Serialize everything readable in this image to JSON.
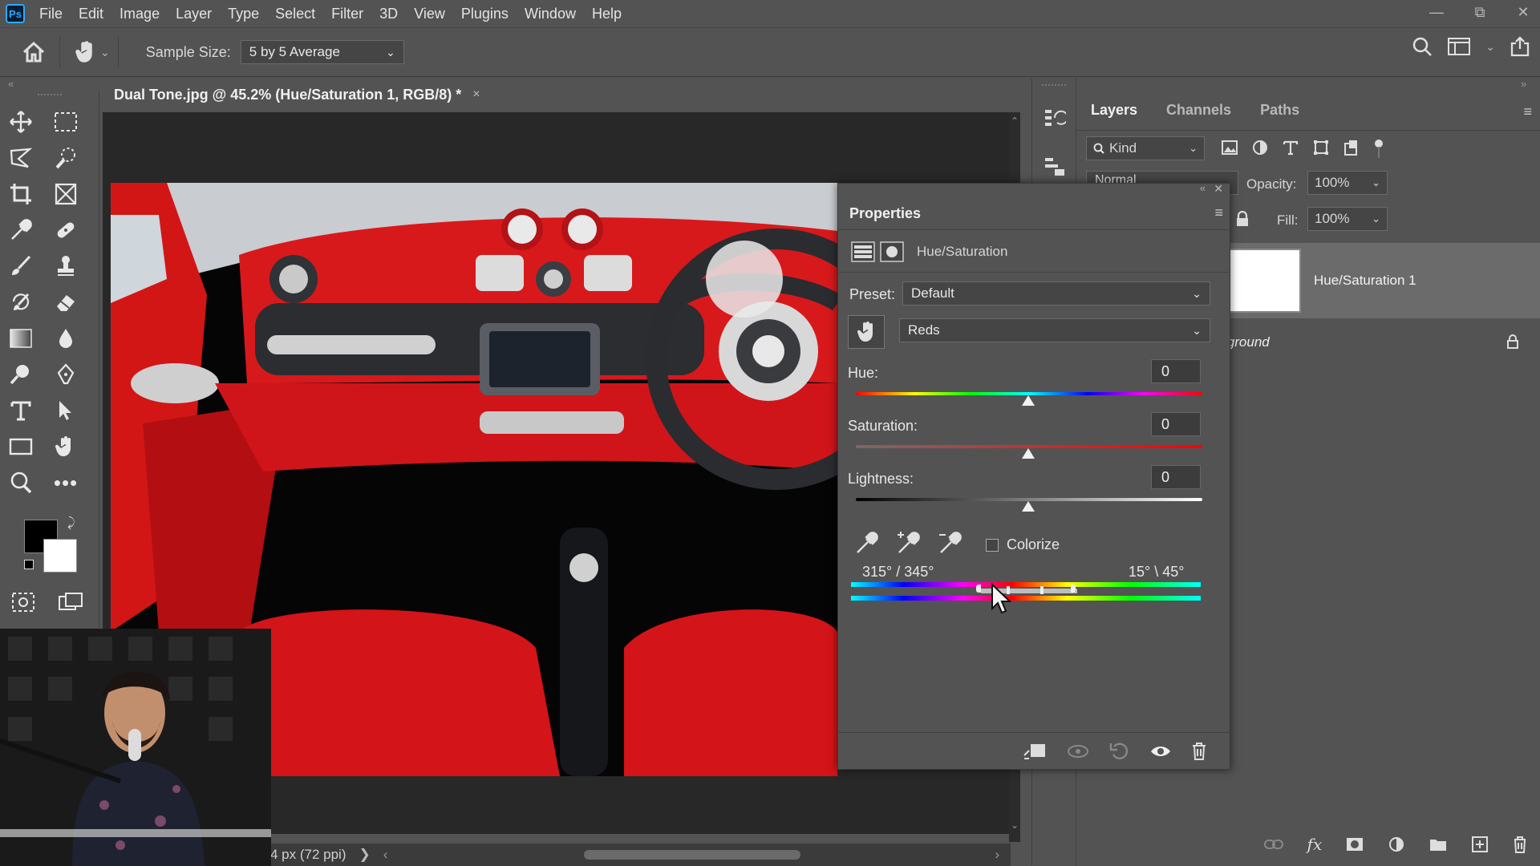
{
  "app": {
    "logo": "Ps",
    "menu": [
      "File",
      "Edit",
      "Image",
      "Layer",
      "Type",
      "Select",
      "Filter",
      "3D",
      "View",
      "Plugins",
      "Window",
      "Help"
    ]
  },
  "window_controls": {
    "minimize": "—",
    "restore": "⧉",
    "close": "✕"
  },
  "options_bar": {
    "sample_size_label": "Sample Size:",
    "sample_size_value": "5 by 5 Average"
  },
  "document": {
    "tab_title": "Dual Tone.jpg @ 45.2% (Hue/Saturation 1, RGB/8) *",
    "close": "×",
    "status_text": "4 px (72 ppi)",
    "status_arrow": "❯",
    "scroll_left": "‹",
    "scroll_right": "›"
  },
  "layers_panel": {
    "tabs": [
      "Layers",
      "Channels",
      "Paths"
    ],
    "filter_kind": "Kind",
    "blend_mode_partial": "Normal",
    "opacity_label": "Opacity:",
    "opacity_value": "100%",
    "fill_label": "Fill:",
    "fill_value": "100%",
    "layers": [
      {
        "name": "Hue/Saturation 1",
        "selected": true
      },
      {
        "name": "Background",
        "locked": true
      }
    ]
  },
  "properties_panel": {
    "title": "Properties",
    "adjustment_name": "Hue/Saturation",
    "preset_label": "Preset:",
    "preset_value": "Default",
    "channel_value": "Reds",
    "hue_label": "Hue:",
    "hue_value": "0",
    "saturation_label": "Saturation:",
    "saturation_value": "0",
    "lightness_label": "Lightness:",
    "lightness_value": "0",
    "colorize_label": "Colorize",
    "colorize_checked": false,
    "range_left": "315° / 345°",
    "range_right": "15° \\ 45°"
  },
  "colors": {
    "panel_bg": "#535353",
    "canvas_bg": "#282828",
    "accent_blue": "#31a8ff",
    "foreground_swatch": "#000000",
    "background_swatch": "#ffffff"
  }
}
